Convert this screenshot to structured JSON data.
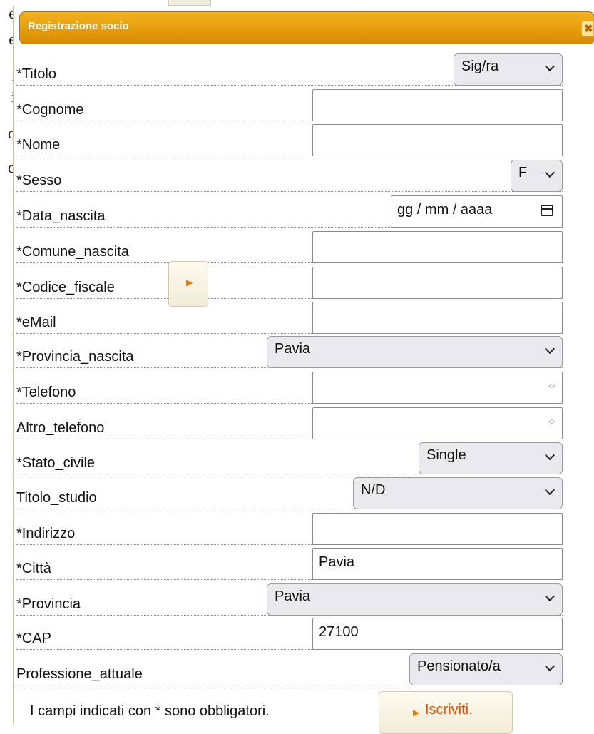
{
  "background_text": {
    "lines": [
      "e",
      "e",
      ",",
      "i",
      "o",
      "o"
    ]
  },
  "dialog": {
    "title": "Registrazione socio",
    "close_icon": "close-icon"
  },
  "fields": [
    {
      "label": "*Titolo",
      "value": "Sig/ra"
    },
    {
      "label": "*Cognome",
      "value": ""
    },
    {
      "label": "*Nome",
      "value": ""
    },
    {
      "label": "*Sesso",
      "value": "F"
    },
    {
      "label": "*Data_nascita",
      "placeholder": "gg / mm / aaaa"
    },
    {
      "label": "*Comune_nascita",
      "value": ""
    },
    {
      "label": "*Codice_fiscale",
      "value": ""
    },
    {
      "label": "*eMail",
      "value": ""
    },
    {
      "label": "*Provincia_nascita",
      "value": "Pavia"
    },
    {
      "label": "*Telefono",
      "value": ""
    },
    {
      "label": "Altro_telefono",
      "value": ""
    },
    {
      "label": "*Stato_civile",
      "value": "Single"
    },
    {
      "label": "Titolo_studio",
      "value": "N/D"
    },
    {
      "label": "*Indirizzo",
      "value": ""
    },
    {
      "label": "*Città",
      "value": "Pavia"
    },
    {
      "label": "*Provincia",
      "value": "Pavia"
    },
    {
      "label": "*CAP",
      "value": "27100"
    },
    {
      "label": "Professione_attuale",
      "value": "Pensionato/a"
    }
  ],
  "footer": {
    "note": "I campi indicati con * sono obbligatori.",
    "submit_label": "Iscriviti."
  },
  "colors": {
    "titlebar": "#e89c00",
    "accent": "#ea5000"
  }
}
